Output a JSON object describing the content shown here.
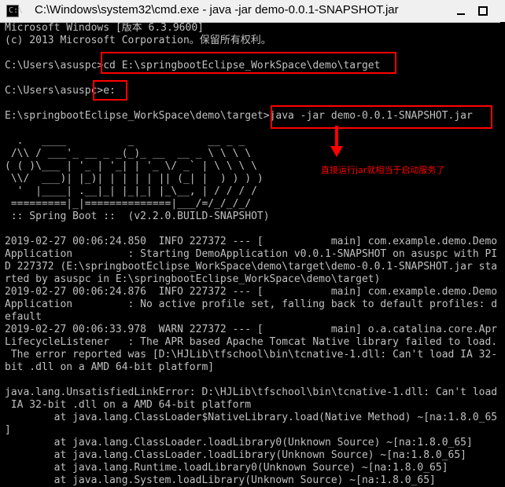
{
  "window": {
    "title": "C:\\Windows\\system32\\cmd.exe - java  -jar demo-0.0.1-SNAPSHOT.jar",
    "icon": "cmd-icon",
    "icon_glyph": "C:\\"
  },
  "console_lines": [
    "Microsoft Windows [版本 6.3.9600]",
    "(c) 2013 Microsoft Corporation。保留所有权利。",
    "",
    "C:\\Users\\asuspc>cd E:\\springbootEclipse_WorkSpace\\demo\\target",
    "",
    "C:\\Users\\asuspc>e:",
    "",
    "E:\\springbootEclipse_WorkSpace\\demo\\target>java -jar demo-0.0.1-SNAPSHOT.jar",
    "",
    "  .   ____          _            __ _ _",
    " /\\\\ / ___'_ __ _ _(_)_ __  __ _ \\ \\ \\ \\",
    "( ( )\\___ | '_ | '_| | '_ \\/ _` | \\ \\ \\ \\",
    " \\\\/  ___)| |_)| | | | | || (_| |  ) ) ) )",
    "  '  |____| .__|_| |_|_| |_\\__, | / / / /",
    " =========|_|==============|___/=/_/_/_/",
    " :: Spring Boot ::  (v2.2.0.BUILD-SNAPSHOT)",
    "",
    "2019-02-27 00:06:24.850  INFO 227372 --- [           main] com.example.demo.Demo",
    "Application         : Starting DemoApplication v0.0.1-SNAPSHOT on asuspc with PI",
    "D 227372 (E:\\springbootEclipse_WorkSpace\\demo\\target\\demo-0.0.1-SNAPSHOT.jar sta",
    "rted by asuspc in E:\\springbootEclipse_WorkSpace\\demo\\target)",
    "2019-02-27 00:06:24.876  INFO 227372 --- [           main] com.example.demo.Demo",
    "Application         : No active profile set, falling back to default profiles: d",
    "efault",
    "2019-02-27 00:06:33.978  WARN 227372 --- [           main] o.a.catalina.core.Apr",
    "LifecycleListener   : The APR based Apache Tomcat Native library failed to load.",
    " The error reported was [D:\\HJLib\\tfschool\\bin\\tcnative-1.dll: Can't load IA 32-",
    "bit .dll on a AMD 64-bit platform]",
    "",
    "java.lang.UnsatisfiedLinkError: D:\\HJLib\\tfschool\\bin\\tcnative-1.dll: Can't load",
    " IA 32-bit .dll on a AMD 64-bit platform",
    "        at java.lang.ClassLoader$NativeLibrary.load(Native Method) ~[na:1.8.0_65",
    "]",
    "        at java.lang.ClassLoader.loadLibrary0(Unknown Source) ~[na:1.8.0_65]",
    "        at java.lang.ClassLoader.loadLibrary(Unknown Source) ~[na:1.8.0_65]",
    "        at java.lang.Runtime.loadLibrary0(Unknown Source) ~[na:1.8.0_65]",
    "        at java.lang.System.loadLibrary(Unknown Source) ~[na:1.8.0_65]"
  ],
  "annotation": {
    "text": "直接运行jar就相当于启动服务了",
    "color": "#ff0000"
  },
  "colors": {
    "console_bg": "#000000",
    "console_text": "#c0c0c0",
    "highlight": "#ff0000"
  }
}
